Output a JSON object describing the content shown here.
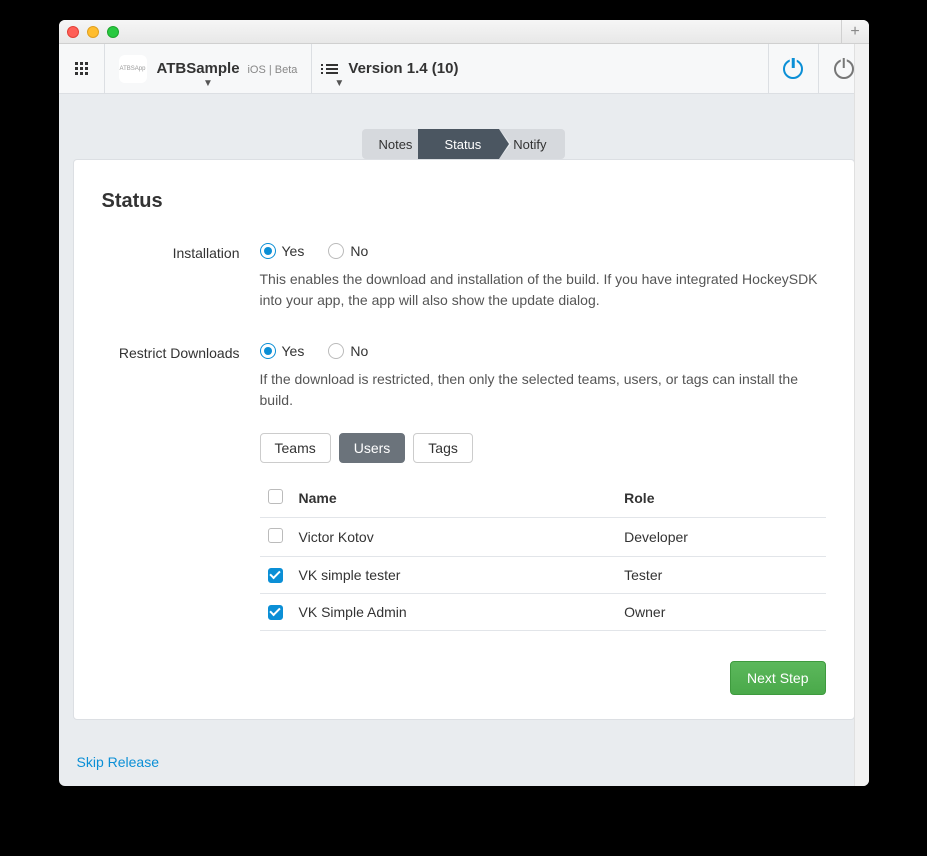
{
  "toolbar": {
    "app_logo_text": "ATBSApp",
    "app_name": "ATBSample",
    "app_meta": "iOS | Beta",
    "version_label": "Version 1.4 (10)"
  },
  "wizard": {
    "steps": [
      "Notes",
      "Status",
      "Notify"
    ],
    "active_index": 1
  },
  "page": {
    "title": "Status",
    "installation": {
      "label": "Installation",
      "options": {
        "yes": "Yes",
        "no": "No"
      },
      "selected": "yes",
      "help": "This enables the download and installation of the build. If you have integrated HockeySDK into your app, the app will also show the update dialog."
    },
    "restrict": {
      "label": "Restrict Downloads",
      "options": {
        "yes": "Yes",
        "no": "No"
      },
      "selected": "yes",
      "help": "If the download is restricted, then only the selected teams, users, or tags can install the build."
    },
    "filter_tabs": {
      "teams": "Teams",
      "users": "Users",
      "tags": "Tags",
      "active": "users"
    },
    "table": {
      "headers": {
        "name": "Name",
        "role": "Role"
      },
      "rows": [
        {
          "name": "Victor Kotov",
          "role": "Developer",
          "checked": false
        },
        {
          "name": "VK simple tester",
          "role": "Tester",
          "checked": true
        },
        {
          "name": "VK Simple Admin",
          "role": "Owner",
          "checked": true
        }
      ]
    },
    "next_button": "Next Step",
    "skip_link": "Skip Release"
  }
}
